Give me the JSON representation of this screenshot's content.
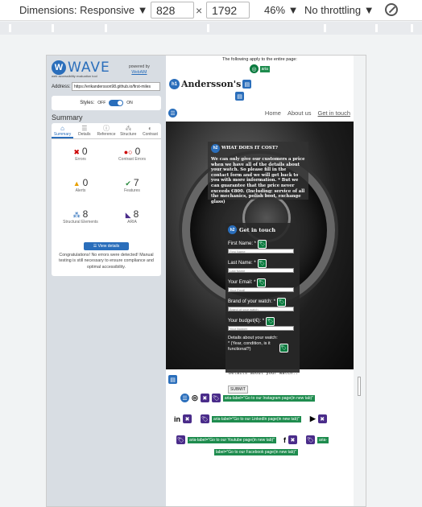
{
  "devtools": {
    "dimensions_label": "Dimensions: Responsive ▼",
    "width": "828",
    "times": "×",
    "height": "1792",
    "zoom": "46% ▼",
    "throttle": "No throttling ▼"
  },
  "wave": {
    "logo_text": "WAVE",
    "tagline": "web accessibility evaluation tool",
    "powered_by": "powered by",
    "webaim": "WebAIM",
    "address_label": "Address:",
    "address_value": "https://erikandersson98.github.io/first-miles",
    "styles_label": "Styles:",
    "styles_off": "OFF",
    "styles_on": "ON",
    "summary_heading": "Summary",
    "tabs": [
      "Summary",
      "Details",
      "Reference",
      "Structure",
      "Contrast"
    ],
    "stats": {
      "errors": {
        "num": "0",
        "label": "Errors"
      },
      "contrast": {
        "num": "0",
        "label": "Contrast Errors"
      },
      "alerts": {
        "num": "0",
        "label": "Alerts"
      },
      "features": {
        "num": "7",
        "label": "Features"
      },
      "structural": {
        "num": "8",
        "label": "Structural Elements"
      },
      "aria": {
        "num": "8",
        "label": "ARIA"
      }
    },
    "view_details": "View details",
    "congrats": "Congratulations! No errors were detected! Manual testing is still necessary to ensure compliance and optimal accessibility."
  },
  "site": {
    "banner": "The following apply to the entire page:",
    "aria_tag_top": "aria",
    "h1_badge": "h1",
    "brand": "Andersson's",
    "nav": [
      "Home",
      "About us",
      "Get in touch"
    ],
    "cost_h2": "h2",
    "cost_heading": "WHAT DOES IT COST?",
    "cost_text": "We can only give our customers a price when we have all of the details about your watch. So please fill in the contact form and we will get back to you with more information. * But we can guarantee that the price never exceeds €800. (Including: service of all the mechanics, polish boot, exchange glass)",
    "form_h2": "h2",
    "form_heading": "Get in touch",
    "fields": [
      {
        "label": "First Name: *",
        "placeholder": "First Name"
      },
      {
        "label": "Last Name: *",
        "placeholder": "Last Name"
      },
      {
        "label": "Your Email: *",
        "placeholder": "Your Email"
      },
      {
        "label": "Brand of your watch: *",
        "placeholder": "Brand of your watch"
      },
      {
        "label": "Your budget(€): *",
        "placeholder": "Your Budget"
      }
    ],
    "details_label": "Details about your watch: * (Year, condition, is it functional?)",
    "details_placeholder": "Details about your watch..",
    "submit": "SUBMIT",
    "aria_instagram": "aria-label=\"Go to our Instagram page(in new tab)\"",
    "aria_linkedin": "aria-label=\"Go to our LinkedIn page(in new tab)\"",
    "aria_youtube": "aria-label=\"Go to our Youtube page(in new tab)\"",
    "aria_facebook_a": "aria-",
    "aria_facebook_b": "label=\"Go to our Facebook page(in new tab)\""
  }
}
